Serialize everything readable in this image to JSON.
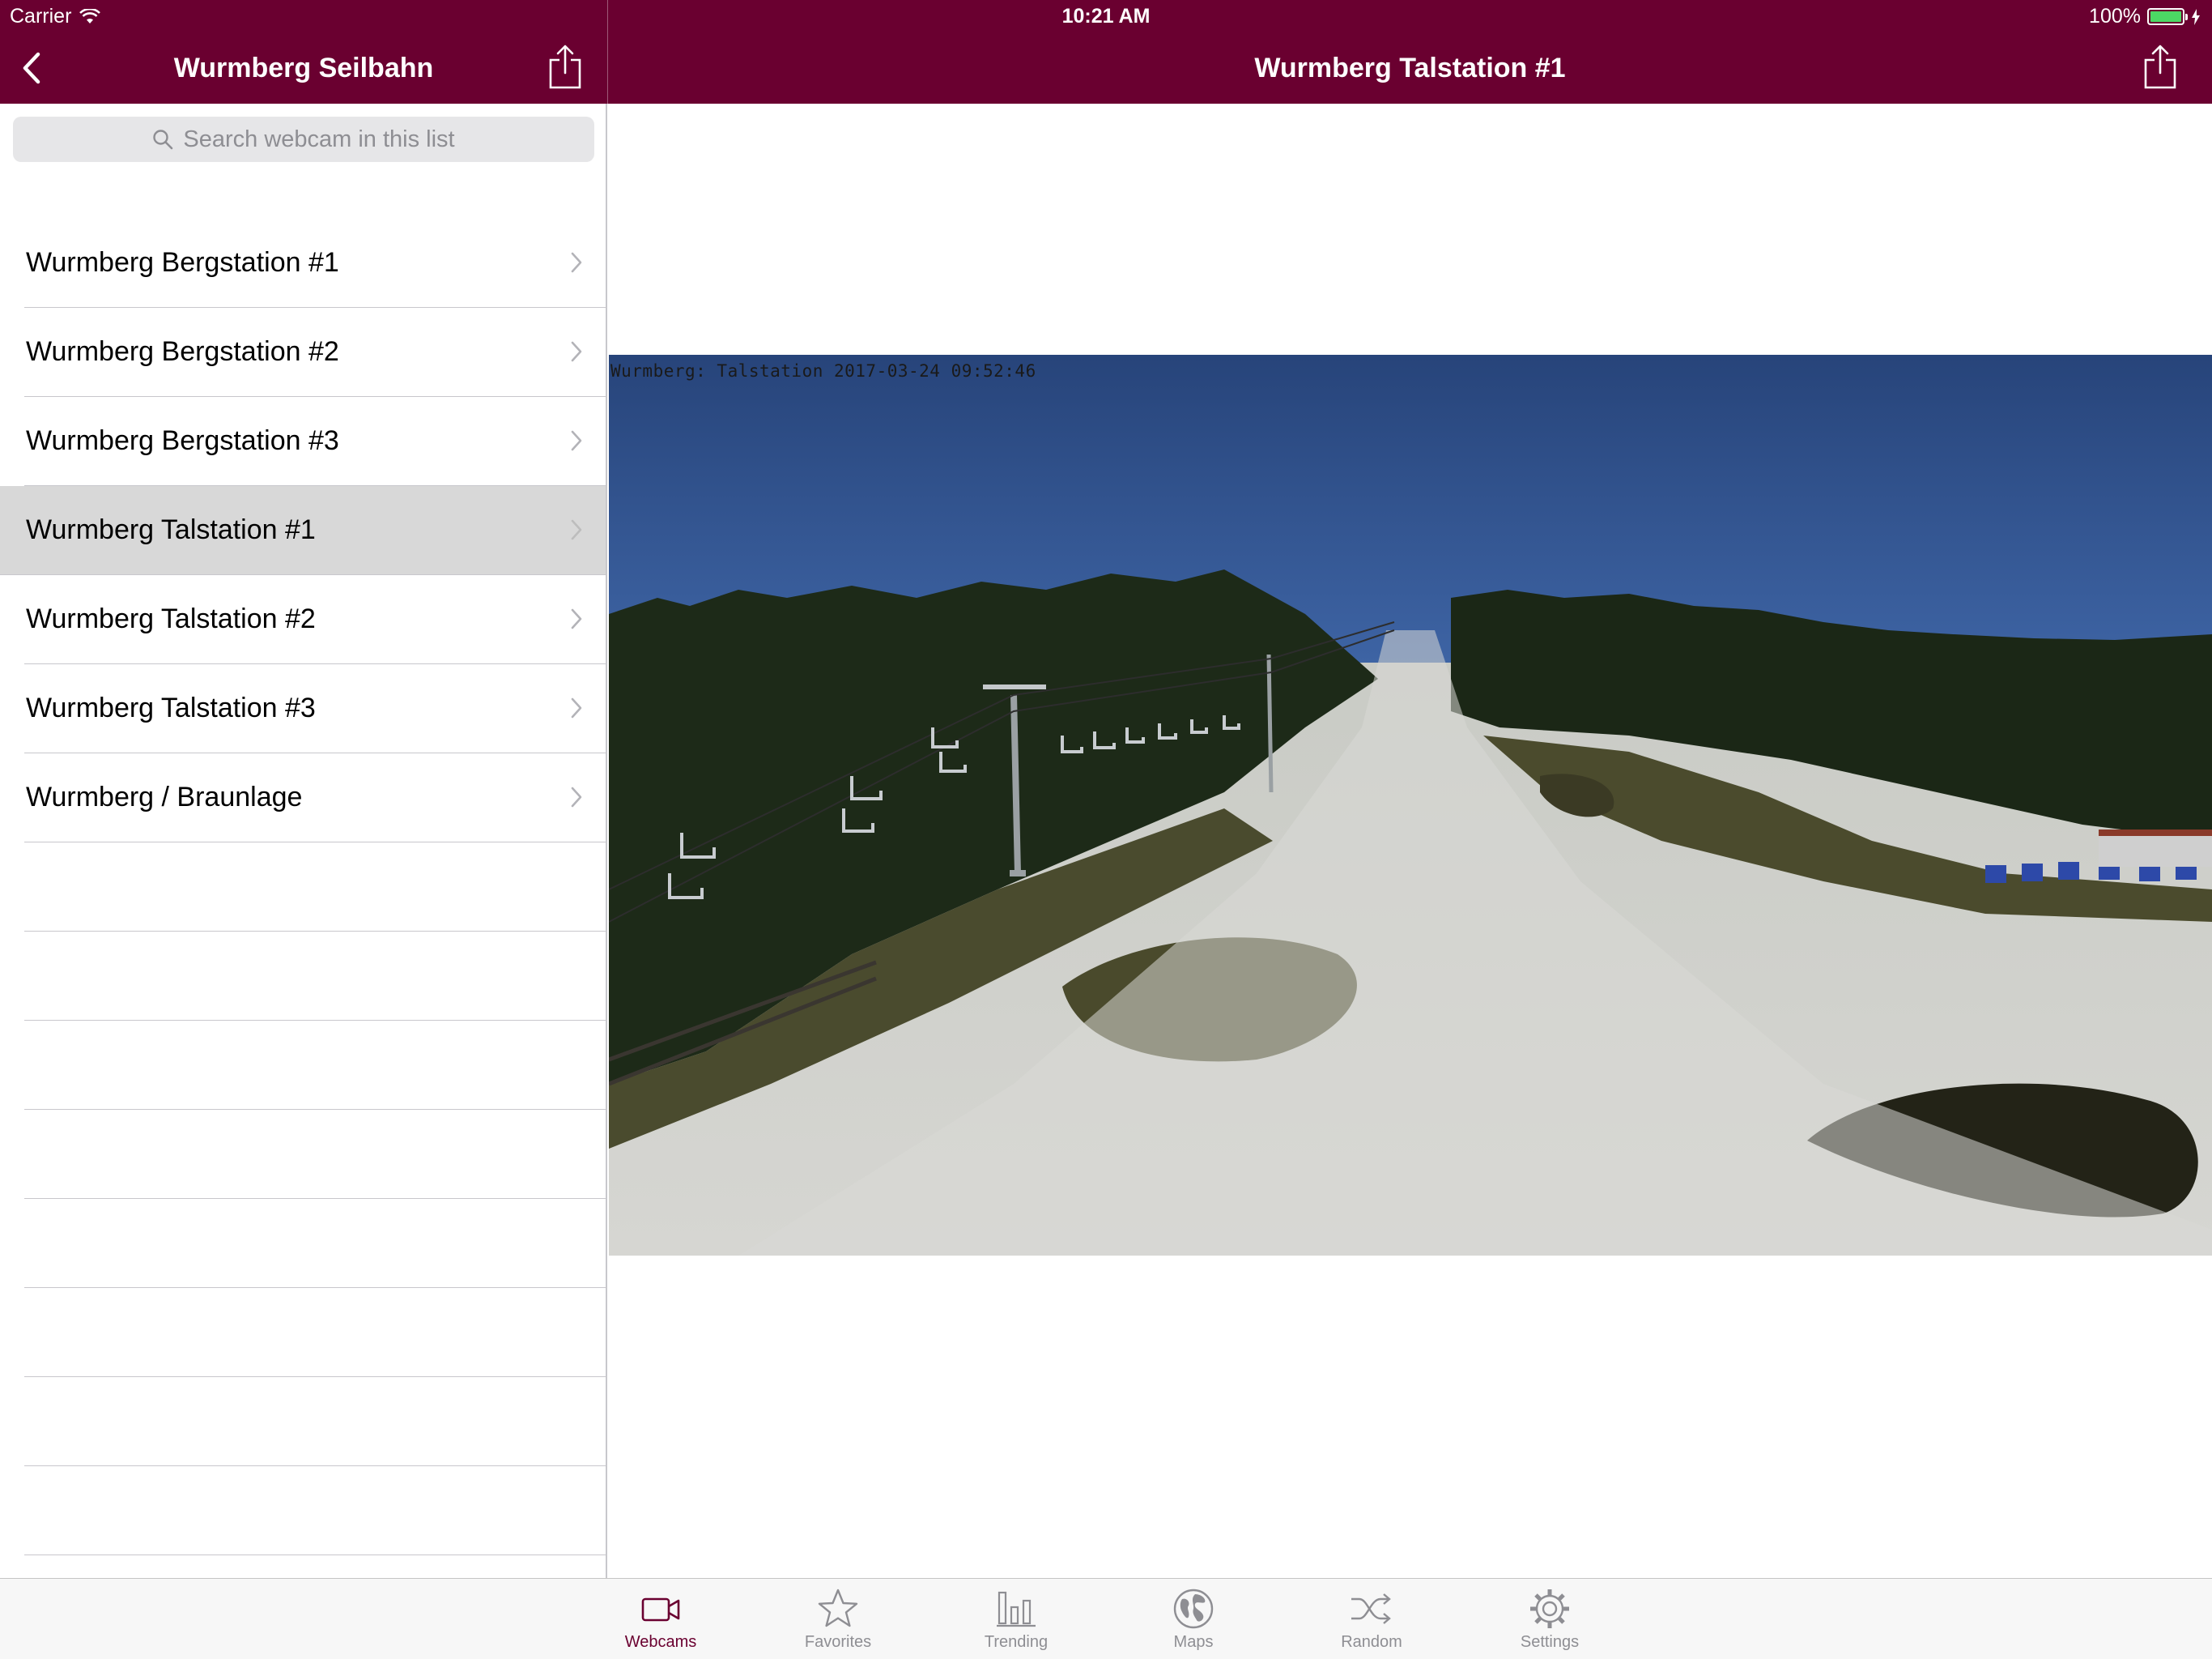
{
  "status_bar": {
    "carrier": "Carrier",
    "time": "10:21 AM",
    "battery": "100%",
    "battery_level": 1.0
  },
  "master": {
    "title": "Wurmberg Seilbahn",
    "search_placeholder": "Search webcam in this list",
    "items": [
      {
        "label": "Wurmberg Bergstation #1",
        "selected": false
      },
      {
        "label": "Wurmberg Bergstation #2",
        "selected": false
      },
      {
        "label": "Wurmberg Bergstation #3",
        "selected": false
      },
      {
        "label": "Wurmberg Talstation #1",
        "selected": true
      },
      {
        "label": "Wurmberg Talstation #2",
        "selected": false
      },
      {
        "label": "Wurmberg Talstation #3",
        "selected": false
      },
      {
        "label": "Wurmberg / Braunlage",
        "selected": false
      }
    ]
  },
  "detail": {
    "title": "Wurmberg Talstation #1",
    "image_caption": "Wurmberg: Talstation 2017-03-24 09:52:46"
  },
  "tabbar": {
    "tabs": [
      {
        "label": "Webcams",
        "icon": "video-camera-icon",
        "active": true
      },
      {
        "label": "Favorites",
        "icon": "star-icon",
        "active": false
      },
      {
        "label": "Trending",
        "icon": "bar-chart-icon",
        "active": false
      },
      {
        "label": "Maps",
        "icon": "globe-icon",
        "active": false
      },
      {
        "label": "Random",
        "icon": "shuffle-icon",
        "active": false
      },
      {
        "label": "Settings",
        "icon": "gear-icon",
        "active": false
      }
    ]
  },
  "colors": {
    "brand": "#6a0030",
    "selected_row": "#d8d8d8",
    "tab_inactive": "#8e8e93"
  }
}
